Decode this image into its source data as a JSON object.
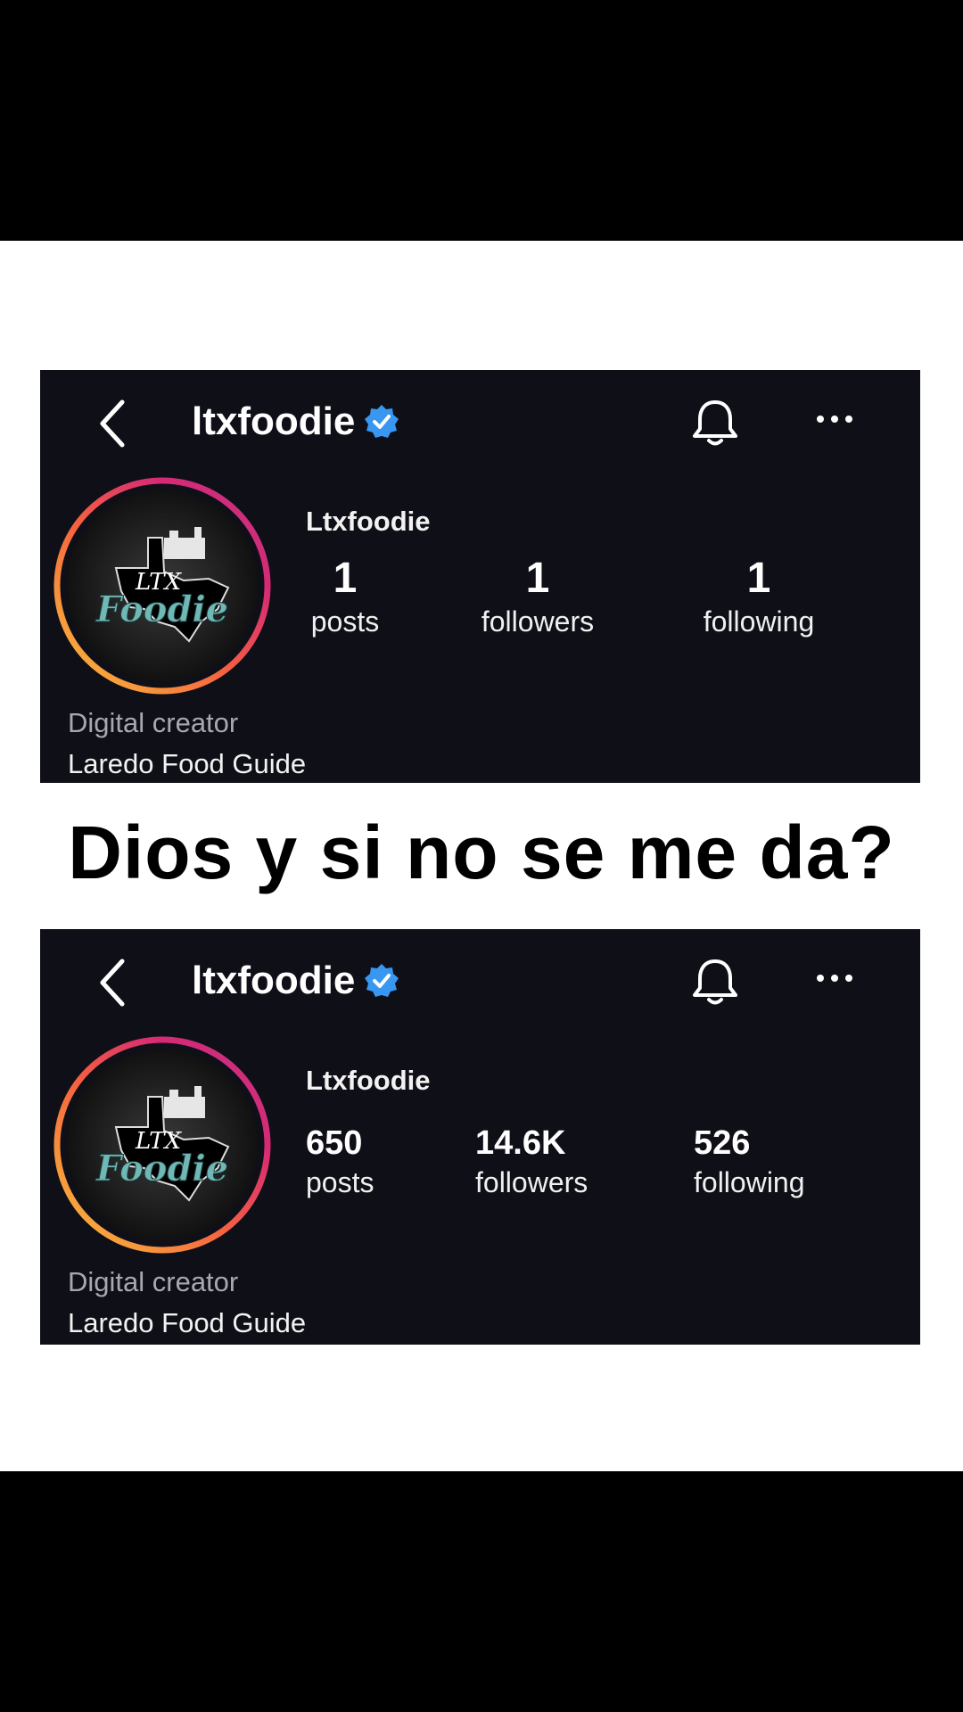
{
  "caption": "Dios y si no se me da?",
  "profiles": [
    {
      "handle": "ltxfoodie",
      "display_name": "Ltxfoodie",
      "stats": [
        {
          "value": "1",
          "label": "posts"
        },
        {
          "value": "1",
          "label": "followers"
        },
        {
          "value": "1",
          "label": "following"
        }
      ],
      "category": "Digital creator",
      "bio": "Laredo Food Guide"
    },
    {
      "handle": "ltxfoodie",
      "display_name": "Ltxfoodie",
      "stats": [
        {
          "value": "650",
          "label": "posts"
        },
        {
          "value": "14.6K",
          "label": "followers"
        },
        {
          "value": "526",
          "label": "following"
        }
      ],
      "category": "Digital creator",
      "bio": "Laredo Food Guide"
    }
  ],
  "avatar_logo": {
    "line1": "LTX",
    "line2": "Foodie"
  },
  "colors": {
    "card_bg": "#0f0f17",
    "verified_blue": "#3897f0",
    "ring_gradient": [
      "#f9c33a",
      "#f56040",
      "#d62976",
      "#c13584"
    ],
    "logo_teal": "#6fb8b5"
  },
  "icons": [
    "chevron-left-icon",
    "verified-badge-icon",
    "bell-icon",
    "more-horizontal-icon"
  ]
}
